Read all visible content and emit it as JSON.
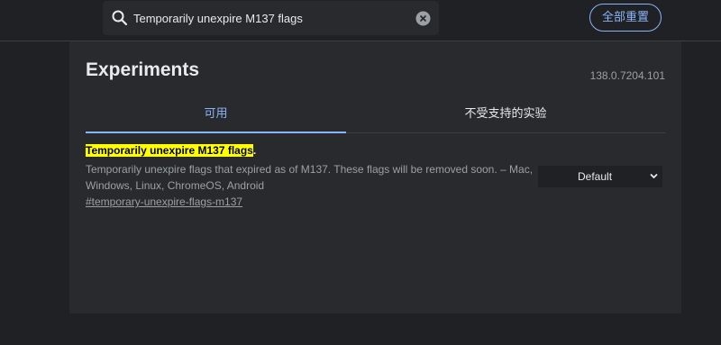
{
  "search": {
    "value": "Temporarily unexpire M137 flags",
    "placeholder": ""
  },
  "header": {
    "reset_label": "全部重置"
  },
  "page": {
    "title": "Experiments",
    "version": "138.0.7204.101"
  },
  "tabs": [
    {
      "label": "可用",
      "active": true
    },
    {
      "label": "不受支持的实验",
      "active": false
    }
  ],
  "flag": {
    "name": "Temporarily unexpire M137 flags",
    "name_suffix": ".",
    "description": "Temporarily unexpire flags that expired as of M137. These flags will be removed soon. – Mac, Windows, Linux, ChromeOS, Android",
    "link": "#temporary-unexpire-flags-m137",
    "selected": "Default"
  },
  "colors": {
    "background": "#202124",
    "panel": "#292a2d",
    "accent": "#8ab4f8",
    "highlight": "#ffff00"
  },
  "icons": {
    "search": "search-icon",
    "clear": "clear-icon",
    "chevron": "chevron-down-icon"
  }
}
